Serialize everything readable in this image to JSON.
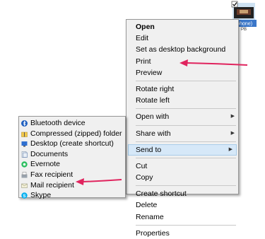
{
  "file_icon": {
    "label": "-phone)",
    "sublabel": "PB"
  },
  "context_menu": {
    "items": [
      {
        "label": "Open",
        "bold": true
      },
      {
        "label": "Edit"
      },
      {
        "label": "Set as desktop background"
      },
      {
        "label": "Print"
      },
      {
        "label": "Preview"
      },
      {
        "label": "Rotate right"
      },
      {
        "label": "Rotate left"
      },
      {
        "label": "Open with"
      },
      {
        "label": "Share with"
      },
      {
        "label": "Send to"
      },
      {
        "label": "Cut"
      },
      {
        "label": "Copy"
      },
      {
        "label": "Create shortcut"
      },
      {
        "label": "Delete"
      },
      {
        "label": "Rename"
      },
      {
        "label": "Properties"
      }
    ]
  },
  "sendto_menu": {
    "items": [
      {
        "label": "Bluetooth device",
        "icon": "bluetooth-icon"
      },
      {
        "label": "Compressed (zipped) folder",
        "icon": "zip-folder-icon"
      },
      {
        "label": "Desktop (create shortcut)",
        "icon": "desktop-icon"
      },
      {
        "label": "Documents",
        "icon": "documents-icon"
      },
      {
        "label": "Evernote",
        "icon": "evernote-icon"
      },
      {
        "label": "Fax recipient",
        "icon": "fax-icon"
      },
      {
        "label": "Mail recipient",
        "icon": "mail-icon"
      },
      {
        "label": "Skype",
        "icon": "skype-icon"
      }
    ]
  },
  "colors": {
    "highlight": "#d6e8f8",
    "arrow": "#e0245e"
  }
}
